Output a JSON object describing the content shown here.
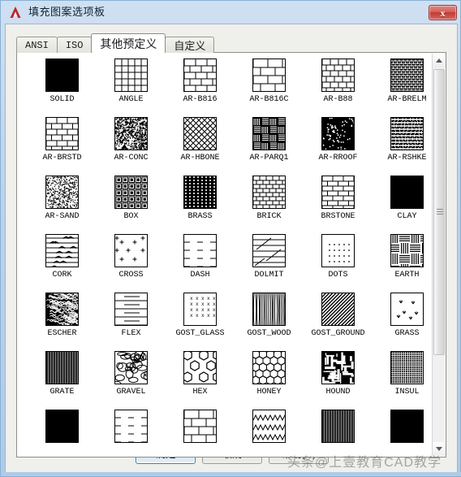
{
  "window": {
    "title": "填充图案选项板",
    "logo_icon": "autocad-a-logo",
    "close_label": "x",
    "close_icon": "close-icon"
  },
  "tabs": [
    {
      "label": "ANSI",
      "active": false,
      "cjk": false
    },
    {
      "label": "ISO",
      "active": false,
      "cjk": false
    },
    {
      "label": "其他预定义",
      "active": true,
      "cjk": true
    },
    {
      "label": "自定义",
      "active": false,
      "cjk": true
    }
  ],
  "patterns": [
    {
      "name": "SOLID",
      "pattern": "solid"
    },
    {
      "name": "ANGLE",
      "pattern": "angle"
    },
    {
      "name": "AR-B816",
      "pattern": "brick-running"
    },
    {
      "name": "AR-B816C",
      "pattern": "brick-wide"
    },
    {
      "name": "AR-B88",
      "pattern": "brick-small"
    },
    {
      "name": "AR-BRELM",
      "pattern": "brick-dense-dark"
    },
    {
      "name": "AR-BRSTD",
      "pattern": "brick-standard"
    },
    {
      "name": "AR-CONC",
      "pattern": "concrete-speckle"
    },
    {
      "name": "AR-HBONE",
      "pattern": "herringbone"
    },
    {
      "name": "AR-PARQ1",
      "pattern": "parquet"
    },
    {
      "name": "AR-RROOF",
      "pattern": "roof-dark-speckle"
    },
    {
      "name": "AR-RSHKE",
      "pattern": "shake-shingle"
    },
    {
      "name": "AR-SAND",
      "pattern": "sand-speckle"
    },
    {
      "name": "BOX",
      "pattern": "box"
    },
    {
      "name": "BRASS",
      "pattern": "brass-vertical"
    },
    {
      "name": "BRICK",
      "pattern": "brick-fine"
    },
    {
      "name": "BRSTONE",
      "pattern": "brickstone"
    },
    {
      "name": "CLAY",
      "pattern": "solid"
    },
    {
      "name": "CORK",
      "pattern": "cork"
    },
    {
      "name": "CROSS",
      "pattern": "cross"
    },
    {
      "name": "DASH",
      "pattern": "dash"
    },
    {
      "name": "DOLMIT",
      "pattern": "dolmit"
    },
    {
      "name": "DOTS",
      "pattern": "dots"
    },
    {
      "name": "EARTH",
      "pattern": "earth"
    },
    {
      "name": "ESCHER",
      "pattern": "escher"
    },
    {
      "name": "FLEX",
      "pattern": "flex"
    },
    {
      "name": "GOST_GLASS",
      "pattern": "gost-glass"
    },
    {
      "name": "GOST_WOOD",
      "pattern": "gost-wood"
    },
    {
      "name": "GOST_GROUND",
      "pattern": "gost-ground"
    },
    {
      "name": "GRASS",
      "pattern": "grass"
    },
    {
      "name": "GRATE",
      "pattern": "grate"
    },
    {
      "name": "GRAVEL",
      "pattern": "gravel"
    },
    {
      "name": "HEX",
      "pattern": "hex"
    },
    {
      "name": "HONEY",
      "pattern": "honey"
    },
    {
      "name": "HOUND",
      "pattern": "hound"
    },
    {
      "name": "INSUL",
      "pattern": "insul"
    },
    {
      "name": "",
      "pattern": "solid"
    },
    {
      "name": "",
      "pattern": "dash"
    },
    {
      "name": "",
      "pattern": "brick-wide"
    },
    {
      "name": "",
      "pattern": "zigzag"
    },
    {
      "name": "",
      "pattern": "grate"
    },
    {
      "name": "",
      "pattern": "solid"
    }
  ],
  "scrollbar": {
    "up_icon": "scroll-up-arrow",
    "down_icon": "scroll-down-arrow",
    "thumb_icon": "scroll-thumb"
  },
  "buttons": {
    "ok": "确定",
    "cancel": "取消",
    "help": "帮助(H)"
  },
  "watermark": {
    "text": "头条@上壹教育CAD教学"
  }
}
